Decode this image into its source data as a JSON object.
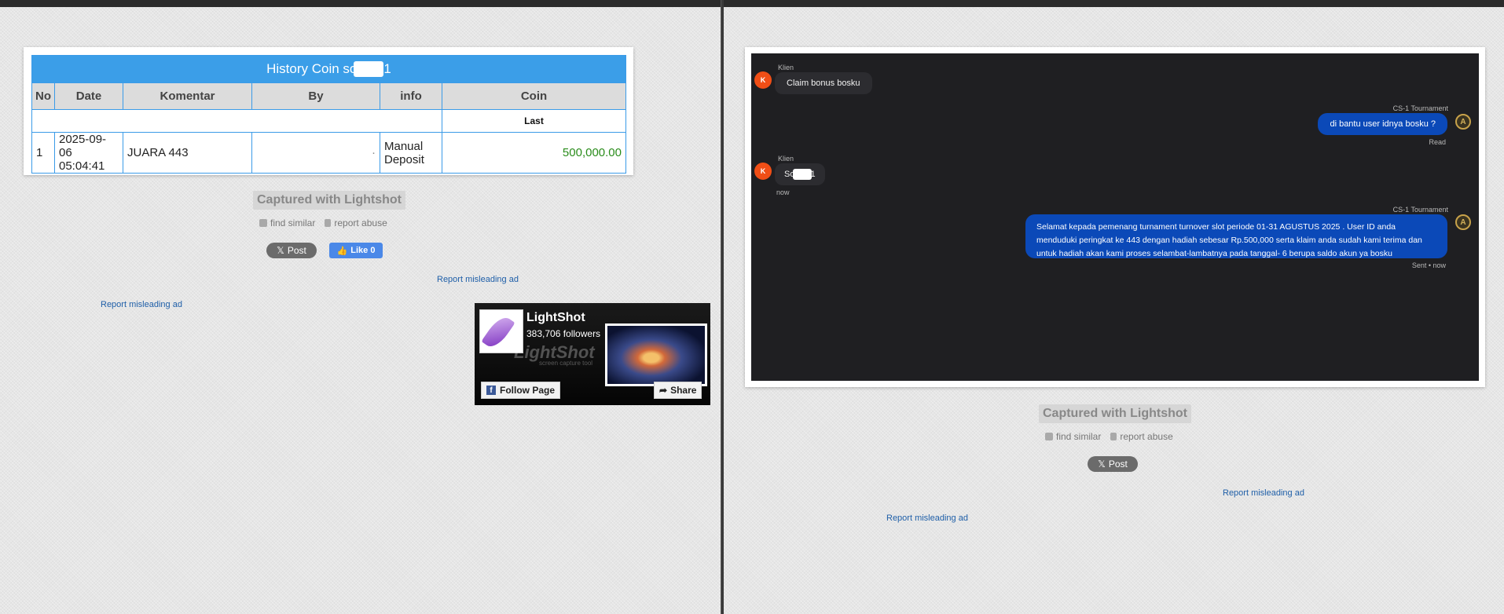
{
  "left_panel": {
    "table": {
      "title": "History Coin so",
      "title_suffix": "1",
      "headers": [
        "No",
        "Date",
        "Komentar",
        "By",
        "info",
        "Coin"
      ],
      "subheader": "Last",
      "rows": [
        {
          "no": "1",
          "date_line1": "2025-09-06",
          "date_line2": "05:04:41",
          "komentar": "JUARA 443",
          "by": "",
          "by_mark": "·",
          "info_line1": "Manual",
          "info_line2": "Deposit",
          "coin": "500,000.00"
        }
      ]
    },
    "captured_label": "Captured with Lightshot",
    "find_similar": "find similar",
    "report_abuse": "report abuse",
    "post_label": "Post",
    "like_label": "Like 0",
    "report_ad_1": "Report misleading ad",
    "report_ad_2": "Report misleading ad",
    "fb_widget": {
      "page_name": "LightShot",
      "followers": "383,706 followers",
      "watermark": "LightShot",
      "watermark_sub": "screen capture tool",
      "follow_label": "Follow Page",
      "share_label": "Share"
    }
  },
  "right_panel": {
    "messages": [
      {
        "sender": "Klien",
        "avatar": "K",
        "text": "Claim bonus bosku",
        "direction": "in"
      },
      {
        "sender": "CS-1 Tournament",
        "avatar": "A",
        "text": "di bantu user idnya bosku ?",
        "direction": "out",
        "status": "Read"
      },
      {
        "sender": "Klien",
        "avatar": "K",
        "text": "So",
        "text_suffix": "1",
        "direction": "in",
        "status": "now"
      },
      {
        "sender": "CS-1 Tournament",
        "avatar": "A",
        "text": "Selamat kepada pemenang turnament turnover slot periode 01-31 AGUSTUS 2025 . User ID anda menduduki peringkat ke 443 dengan hadiah sebesar Rp.500,000 serta klaim anda sudah kami terima dan untuk hadiah akan kami proses selambat-lambatnya pada tanggal- 6 berupa saldo akun ya bosku",
        "direction": "out",
        "status": "Sent • now"
      }
    ],
    "captured_label": "Captured with Lightshot",
    "find_similar": "find similar",
    "report_abuse": "report abuse",
    "post_label": "Post",
    "report_ad_1": "Report misleading ad",
    "report_ad_2": "Report misleading ad"
  },
  "colors": {
    "table_header_blue": "#3b9ee8",
    "coin_green": "#2a8c1b",
    "chat_bg": "#1f1f22",
    "out_bubble": "#0b49b8",
    "avatar_orange": "#f04e16",
    "link_blue": "#1f5fa8"
  }
}
